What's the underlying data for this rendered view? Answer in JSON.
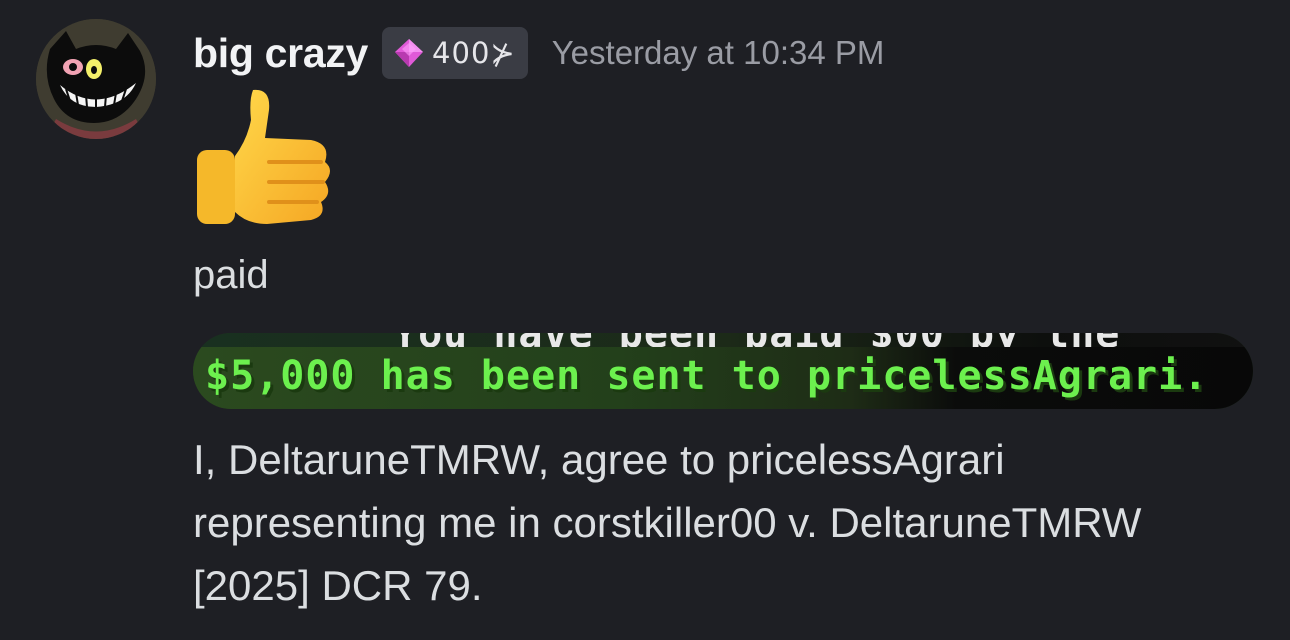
{
  "message": {
    "author": "big crazy",
    "tag_icon": "pink-gem-icon",
    "tag_text": "400⊁",
    "timestamp": "Yesterday at 10:34 PM",
    "emoji": "thumbs-up-emoji",
    "text_paid": "paid",
    "image": {
      "top_partial_text": "You have been paid $00 by the",
      "main_text": "$5,000 has been sent to pricelessAgrari."
    },
    "body_lines": [
      "I, DeltaruneTMRW, agree to pricelessAgrari",
      "representing me in corstkiller00 v. DeltaruneTMRW",
      "[2025] DCR 79."
    ]
  },
  "colors": {
    "background": "#1e1f24",
    "username": "#f2f3f5",
    "timestamp": "#9a9ca4",
    "tag_bg": "#3a3c44",
    "minecraft_green": "#6cf04e"
  }
}
